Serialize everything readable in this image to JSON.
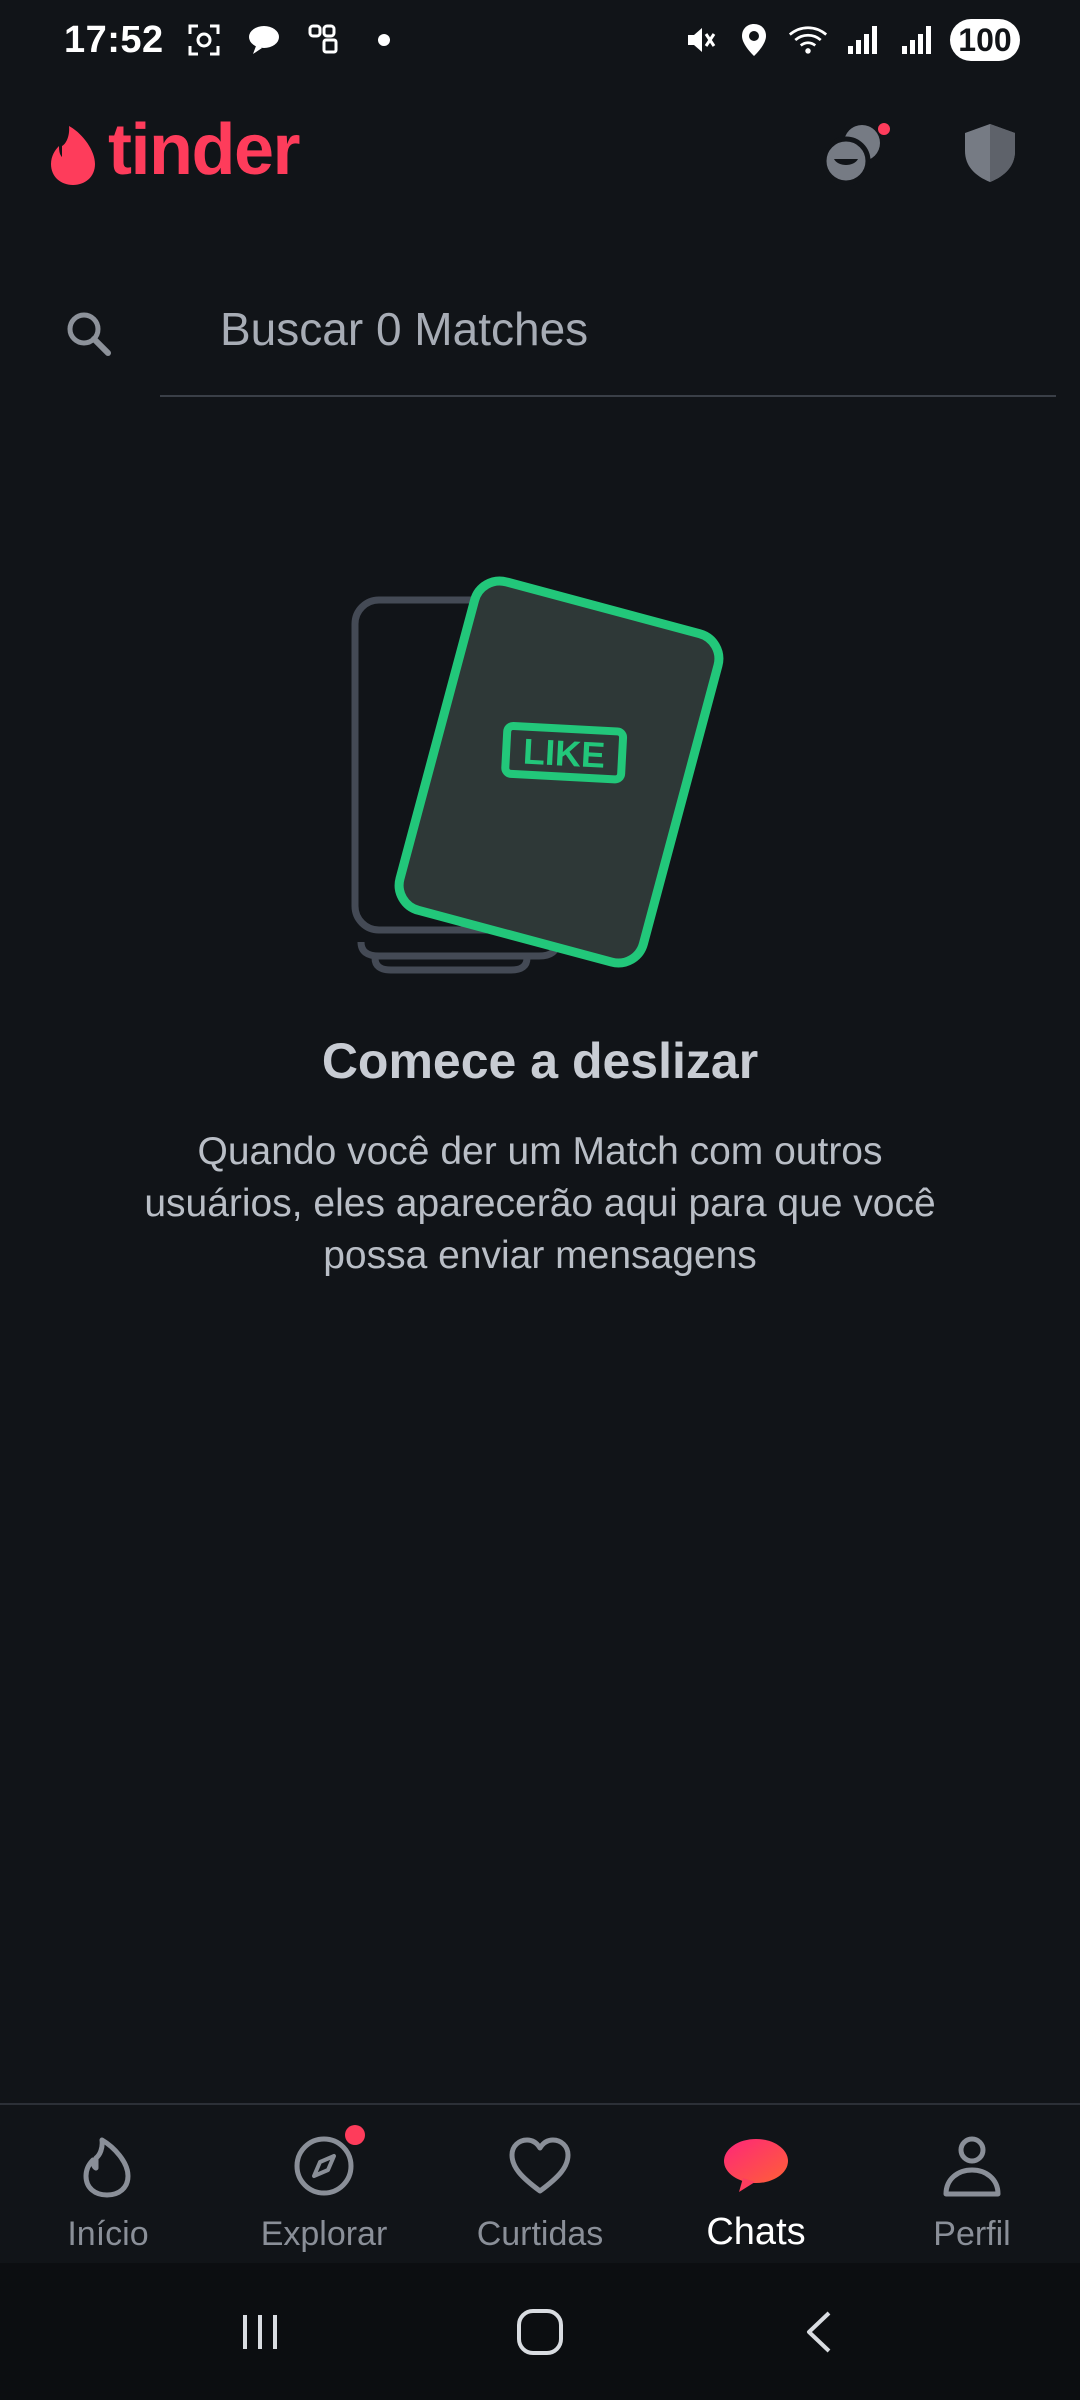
{
  "status_bar": {
    "time": "17:52",
    "battery": "100",
    "icons": [
      "screenshot-icon",
      "chat-bubble-icon",
      "app-icon",
      "dot-icon",
      "mute-icon",
      "location-icon",
      "wifi-icon",
      "signal-icon",
      "signal-icon"
    ]
  },
  "header": {
    "brand": "tinder",
    "brand_color": "#fe3c5b",
    "actions": [
      "matchmaker-icon",
      "shield-icon"
    ]
  },
  "search": {
    "placeholder": "Buscar 0 Matches",
    "value": ""
  },
  "empty_state": {
    "badge_label": "LIKE",
    "accent_color": "#22c77a",
    "title": "Comece a deslizar",
    "description": "Quando você der um Match com outros usuários, eles aparecerão aqui para que você possa enviar mensagens"
  },
  "tabs": [
    {
      "label": "Início",
      "icon": "flame-icon",
      "active": false
    },
    {
      "label": "Explorar",
      "icon": "compass-icon",
      "active": false,
      "badge": true
    },
    {
      "label": "Curtidas",
      "icon": "heart-icon",
      "active": false
    },
    {
      "label": "Chats",
      "icon": "chat-icon",
      "active": true
    },
    {
      "label": "Perfil",
      "icon": "person-icon",
      "active": false
    }
  ],
  "system_nav": [
    "recent-apps-icon",
    "home-icon",
    "back-icon"
  ]
}
